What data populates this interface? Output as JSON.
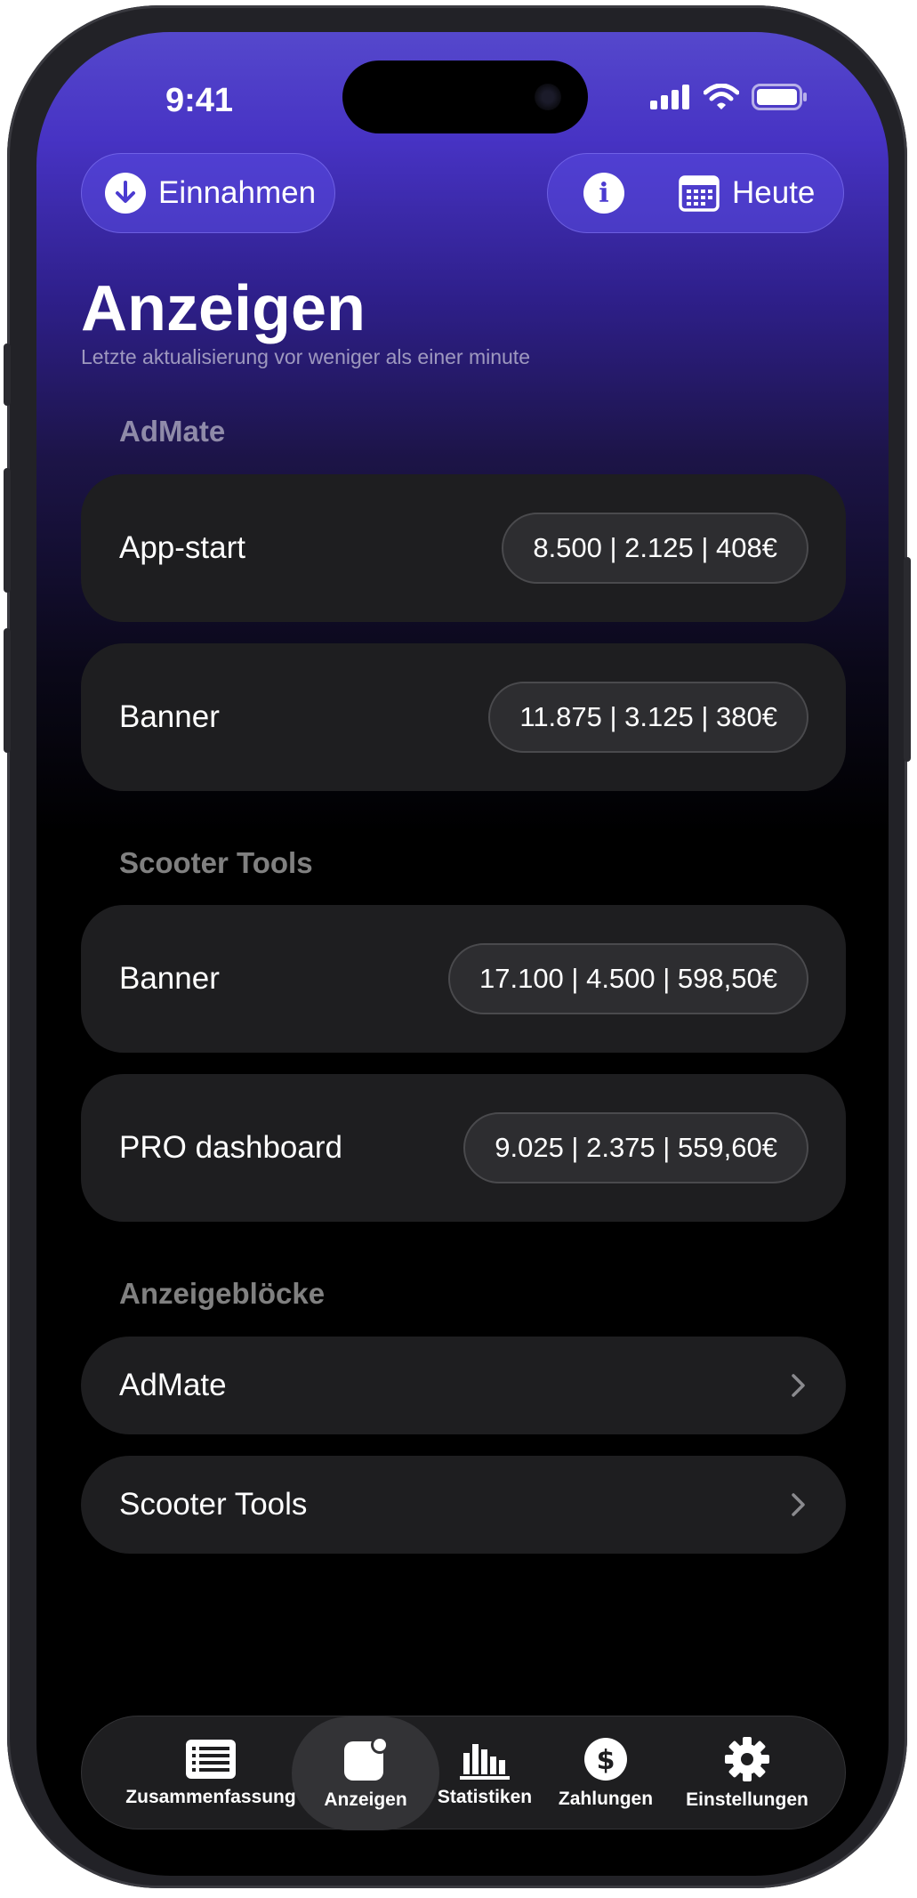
{
  "status_bar": {
    "time": "9:41",
    "icons": [
      "signal-icon",
      "wifi-icon",
      "battery-icon"
    ]
  },
  "header": {
    "left_button": {
      "icon": "arrow-down-icon",
      "label": "Einnahmen"
    },
    "info_icon": "info-icon",
    "date_button": {
      "icon": "calendar-icon",
      "label": "Heute"
    }
  },
  "page": {
    "title": "Anzeigen",
    "subtitle": "Letzte aktualisierung vor weniger als einer minute"
  },
  "sections": [
    {
      "title": "AdMate",
      "items": [
        {
          "label": "App-start",
          "value": "8.500 | 2.125 | 408€"
        },
        {
          "label": "Banner",
          "value": "11.875 | 3.125 | 380€"
        }
      ]
    },
    {
      "title": "Scooter Tools",
      "items": [
        {
          "label": "Banner",
          "value": "17.100 | 4.500 | 598,50€"
        },
        {
          "label": "PRO dashboard",
          "value": "9.025 | 2.375 | 559,60€"
        }
      ]
    }
  ],
  "ad_blocks": {
    "title": "Anzeigeblöcke",
    "items": [
      {
        "label": "AdMate"
      },
      {
        "label": "Scooter Tools"
      }
    ]
  },
  "tabbar": {
    "tabs": [
      {
        "label": "Zusammenfassung",
        "icon": "list-icon",
        "active": false
      },
      {
        "label": "Anzeigen",
        "icon": "ads-icon",
        "active": true
      },
      {
        "label": "Statistiken",
        "icon": "chart-icon",
        "active": false
      },
      {
        "label": "Zahlungen",
        "icon": "dollar-icon",
        "active": false
      },
      {
        "label": "Einstellungen",
        "icon": "gear-icon",
        "active": false
      }
    ]
  },
  "colors": {
    "accent": "#4b3bd0",
    "card": "#1e1e20",
    "pill": "#2d2d30"
  }
}
